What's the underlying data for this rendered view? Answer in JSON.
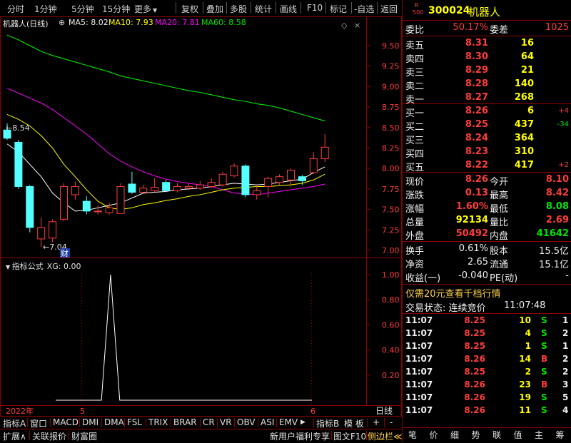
{
  "toolbar": {
    "left": [
      "分时",
      "1分钟",
      "5分钟",
      "15分钟",
      "更多"
    ],
    "right": [
      "复权",
      "叠加",
      "多股",
      "统计",
      "画线",
      "F10",
      "标记",
      "-自选",
      "返回"
    ]
  },
  "legend": {
    "name": "机器人(日线)",
    "ma5": "MA5: 8.02",
    "ma10": "MA10: 7.93",
    "ma20": "MA20: 7.81",
    "ma60": "MA60: 8.58"
  },
  "axis": {
    "price_ticks": [
      "9.50",
      "9.25",
      "9.00",
      "8.75",
      "8.50",
      "8.25",
      "8.00",
      "7.75",
      "7.50",
      "7.25",
      "7.00"
    ],
    "ind_ticks": [
      "1.00",
      "0.80",
      "0.60",
      "0.40",
      "0.20"
    ],
    "date_year": "2022年",
    "date_m5": "5",
    "date_m6": "6",
    "date_period": "日线"
  },
  "annot": {
    "high": "8.54",
    "low": "7.04",
    "cai": "财"
  },
  "indicator": {
    "title": "指标公式",
    "xg": "XG: 0.00"
  },
  "tabs1": [
    "指标A",
    "窗口",
    "MACD",
    "DMI",
    "DMA",
    "FSL",
    "TRIX",
    "BRAR",
    "CR",
    "VR",
    "OBV",
    "ASI",
    "EMV",
    "指标B",
    "模 板",
    "+",
    "-"
  ],
  "tabs2": [
    "扩展∧",
    "关联报价",
    "财富圈",
    "新用户福利专享",
    "图文F10",
    "侧边栏≪"
  ],
  "stock": {
    "code": "300024",
    "name": "机器人",
    "tag_r": "R",
    "tag_500": "500"
  },
  "weibi": {
    "l1": "委比",
    "v1": "50.17%",
    "l2": "委差",
    "v2": "1025"
  },
  "sells": [
    {
      "label": "卖五",
      "price": "8.31",
      "vol": "16"
    },
    {
      "label": "卖四",
      "price": "8.30",
      "vol": "64"
    },
    {
      "label": "卖三",
      "price": "8.29",
      "vol": "21"
    },
    {
      "label": "卖二",
      "price": "8.28",
      "vol": "140"
    },
    {
      "label": "卖一",
      "price": "8.27",
      "vol": "268"
    }
  ],
  "buys": [
    {
      "label": "买一",
      "price": "8.26",
      "vol": "6",
      "chg": "+4"
    },
    {
      "label": "买二",
      "price": "8.25",
      "vol": "437",
      "chg": "-34"
    },
    {
      "label": "买三",
      "price": "8.24",
      "vol": "364",
      "chg": ""
    },
    {
      "label": "买四",
      "price": "8.23",
      "vol": "310",
      "chg": ""
    },
    {
      "label": "买五",
      "price": "8.22",
      "vol": "417",
      "chg": "+2"
    }
  ],
  "quote": [
    {
      "l1": "现价",
      "v1": "8.26",
      "l2": "今开",
      "v2": "8.10"
    },
    {
      "l1": "涨跌",
      "v1": "0.13",
      "l2": "最高",
      "v2": "8.42"
    },
    {
      "l1": "涨幅",
      "v1": "1.60%",
      "l2": "最低",
      "v2": "8.08"
    },
    {
      "l1": "总量",
      "v1": "92134",
      "l2": "量比",
      "v2": "2.69"
    },
    {
      "l1": "外盘",
      "v1": "50492",
      "l2": "内盘",
      "v2": "41642"
    }
  ],
  "stats": [
    {
      "l1": "换手",
      "v1": "0.61%",
      "l2": "股本",
      "v2": "15.5亿"
    },
    {
      "l1": "净资",
      "v1": "2.65",
      "l2": "流通",
      "v2": "15.1亿"
    },
    {
      "l1": "收益(一)",
      "v1": "-0.040",
      "l2": "PE(动)",
      "v2": "-"
    }
  ],
  "promo": "仅需20元查看千档行情",
  "trade_status": {
    "label": "交易状态: 连续竞价",
    "time": "11:07:48"
  },
  "ticks": [
    {
      "t": "11:07",
      "p": "8.25",
      "v": "10",
      "s": "S",
      "n": "1"
    },
    {
      "t": "11:07",
      "p": "8.25",
      "v": "4",
      "s": "S",
      "n": "2"
    },
    {
      "t": "11:07",
      "p": "8.25",
      "v": "1",
      "s": "S",
      "n": "1"
    },
    {
      "t": "11:07",
      "p": "8.26",
      "v": "14",
      "s": "B",
      "n": "2"
    },
    {
      "t": "11:07",
      "p": "8.25",
      "v": "2",
      "s": "S",
      "n": "2"
    },
    {
      "t": "11:07",
      "p": "8.26",
      "v": "23",
      "s": "B",
      "n": "3"
    },
    {
      "t": "11:07",
      "p": "8.26",
      "v": "19",
      "s": "S",
      "n": "5"
    },
    {
      "t": "11:07",
      "p": "8.26",
      "v": "11",
      "s": "S",
      "n": "4"
    }
  ],
  "rtabs": [
    "笔",
    "价",
    "细",
    "势",
    "联",
    "值",
    "主",
    "筹"
  ],
  "chart_data": {
    "type": "candlestick",
    "candles": [
      {
        "o": 8.47,
        "c": 8.37,
        "h": 8.55,
        "l": 8.35
      },
      {
        "o": 8.32,
        "c": 7.78,
        "h": 8.35,
        "l": 7.75
      },
      {
        "o": 7.78,
        "c": 7.28,
        "h": 7.8,
        "l": 7.22
      },
      {
        "o": 7.14,
        "c": 7.28,
        "h": 7.4,
        "l": 7.04
      },
      {
        "o": 7.15,
        "c": 7.35,
        "h": 7.38,
        "l": 7.1
      },
      {
        "o": 7.38,
        "c": 7.78,
        "h": 7.82,
        "l": 7.36
      },
      {
        "o": 7.68,
        "c": 7.78,
        "h": 7.84,
        "l": 7.62
      },
      {
        "o": 7.6,
        "c": 7.48,
        "h": 7.66,
        "l": 7.44
      },
      {
        "o": 7.48,
        "c": 7.48,
        "h": 7.55,
        "l": 7.44
      },
      {
        "o": 7.46,
        "c": 7.52,
        "h": 7.58,
        "l": 7.44
      },
      {
        "o": 7.45,
        "c": 7.78,
        "h": 7.82,
        "l": 7.45
      },
      {
        "o": 7.81,
        "c": 7.71,
        "h": 7.96,
        "l": 7.69
      },
      {
        "o": 7.71,
        "c": 7.76,
        "h": 7.8,
        "l": 7.71
      },
      {
        "o": 7.73,
        "c": 7.77,
        "h": 7.88,
        "l": 7.71
      },
      {
        "o": 7.83,
        "c": 7.73,
        "h": 7.86,
        "l": 7.71
      },
      {
        "o": 7.73,
        "c": 7.78,
        "h": 7.82,
        "l": 7.71
      },
      {
        "o": 7.76,
        "c": 7.78,
        "h": 7.82,
        "l": 7.74
      },
      {
        "o": 7.76,
        "c": 7.8,
        "h": 7.85,
        "l": 7.74
      },
      {
        "o": 7.78,
        "c": 7.83,
        "h": 7.88,
        "l": 7.76
      },
      {
        "o": 7.8,
        "c": 7.93,
        "h": 7.96,
        "l": 7.78
      },
      {
        "o": 7.91,
        "c": 8.03,
        "h": 8.06,
        "l": 7.89
      },
      {
        "o": 8.03,
        "c": 7.68,
        "h": 8.05,
        "l": 7.65
      },
      {
        "o": 7.68,
        "c": 7.73,
        "h": 7.8,
        "l": 7.62
      },
      {
        "o": 7.78,
        "c": 7.88,
        "h": 7.9,
        "l": 7.65
      },
      {
        "o": 7.83,
        "c": 7.9,
        "h": 7.93,
        "l": 7.8
      },
      {
        "o": 7.86,
        "c": 7.98,
        "h": 8.0,
        "l": 7.78
      },
      {
        "o": 7.9,
        "c": 7.85,
        "h": 7.92,
        "l": 7.8
      },
      {
        "o": 7.95,
        "c": 8.12,
        "h": 8.2,
        "l": 7.93
      },
      {
        "o": 8.12,
        "c": 8.26,
        "h": 8.42,
        "l": 8.08
      }
    ],
    "ma5": [
      8.3,
      8.2,
      8.05,
      7.9,
      7.7,
      7.58,
      7.48,
      7.49,
      7.52,
      7.55,
      7.58,
      7.64,
      7.7,
      7.71,
      7.72,
      7.74,
      7.75,
      7.76,
      7.78,
      7.8,
      7.82,
      7.81,
      7.8,
      7.81,
      7.83,
      7.85,
      7.87,
      7.95,
      8.02
    ],
    "ma10": [
      8.66,
      8.6,
      8.52,
      8.4,
      8.25,
      8.05,
      7.9,
      7.74,
      7.6,
      7.52,
      7.5,
      7.52,
      7.56,
      7.58,
      7.61,
      7.63,
      7.66,
      7.68,
      7.71,
      7.74,
      7.76,
      7.77,
      7.78,
      7.78,
      7.79,
      7.8,
      7.82,
      7.86,
      7.93
    ],
    "ma20": [
      8.98,
      8.92,
      8.86,
      8.8,
      8.72,
      8.62,
      8.52,
      8.42,
      8.3,
      8.18,
      8.09,
      8.02,
      7.96,
      7.91,
      7.87,
      7.84,
      7.82,
      7.8,
      7.78,
      7.74,
      7.7,
      7.69,
      7.68,
      7.7,
      7.72,
      7.74,
      7.76,
      7.78,
      7.81
    ],
    "ma60": [
      9.63,
      9.57,
      9.5,
      9.43,
      9.38,
      9.34,
      9.3,
      9.26,
      9.22,
      9.18,
      9.13,
      9.1,
      9.07,
      9.04,
      9.01,
      8.98,
      8.95,
      8.93,
      8.9,
      8.87,
      8.84,
      8.82,
      8.79,
      8.77,
      8.74,
      8.7,
      8.66,
      8.62,
      8.58
    ],
    "xg": [
      0,
      0,
      0,
      0,
      0,
      0,
      1,
      0,
      0,
      0,
      0,
      0,
      0,
      0,
      0,
      0,
      0,
      0,
      0,
      0,
      0,
      0,
      0,
      0,
      0,
      0,
      0,
      0,
      0
    ],
    "ylim": [
      7.0,
      9.6
    ],
    "ind_ylim": [
      0,
      1.0
    ]
  },
  "colors": {
    "up": "#ff3c3c",
    "down": "#54ffff",
    "ma5": "#ffffff",
    "ma10": "#ffff00",
    "ma20": "#ff00ff",
    "ma60": "#00ff00",
    "frame": "#8b0000"
  }
}
